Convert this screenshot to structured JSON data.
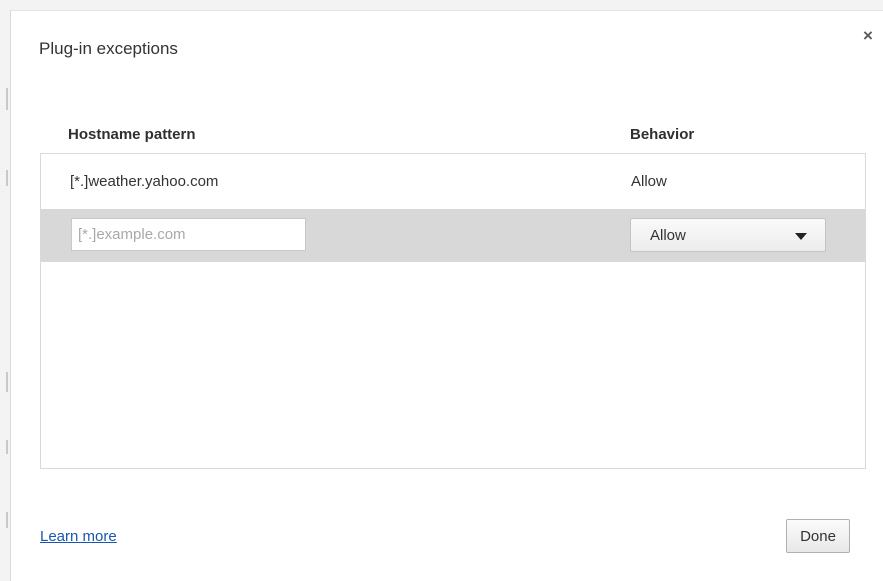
{
  "dialog": {
    "title": "Plug-in exceptions",
    "close_icon": "close-icon",
    "close_glyph": "×"
  },
  "table": {
    "columns": [
      "Hostname pattern",
      "Behavior"
    ],
    "rows": [
      {
        "pattern": "[*.]weather.yahoo.com",
        "behavior": "Allow"
      }
    ],
    "new_row": {
      "pattern_value": "",
      "pattern_placeholder": "[*.]example.com",
      "behavior_selected": "Allow"
    }
  },
  "footer": {
    "learn_more": "Learn more",
    "done_label": "Done"
  },
  "colors": {
    "link": "#1a56b0",
    "selected_row": "#d8d8d8"
  }
}
